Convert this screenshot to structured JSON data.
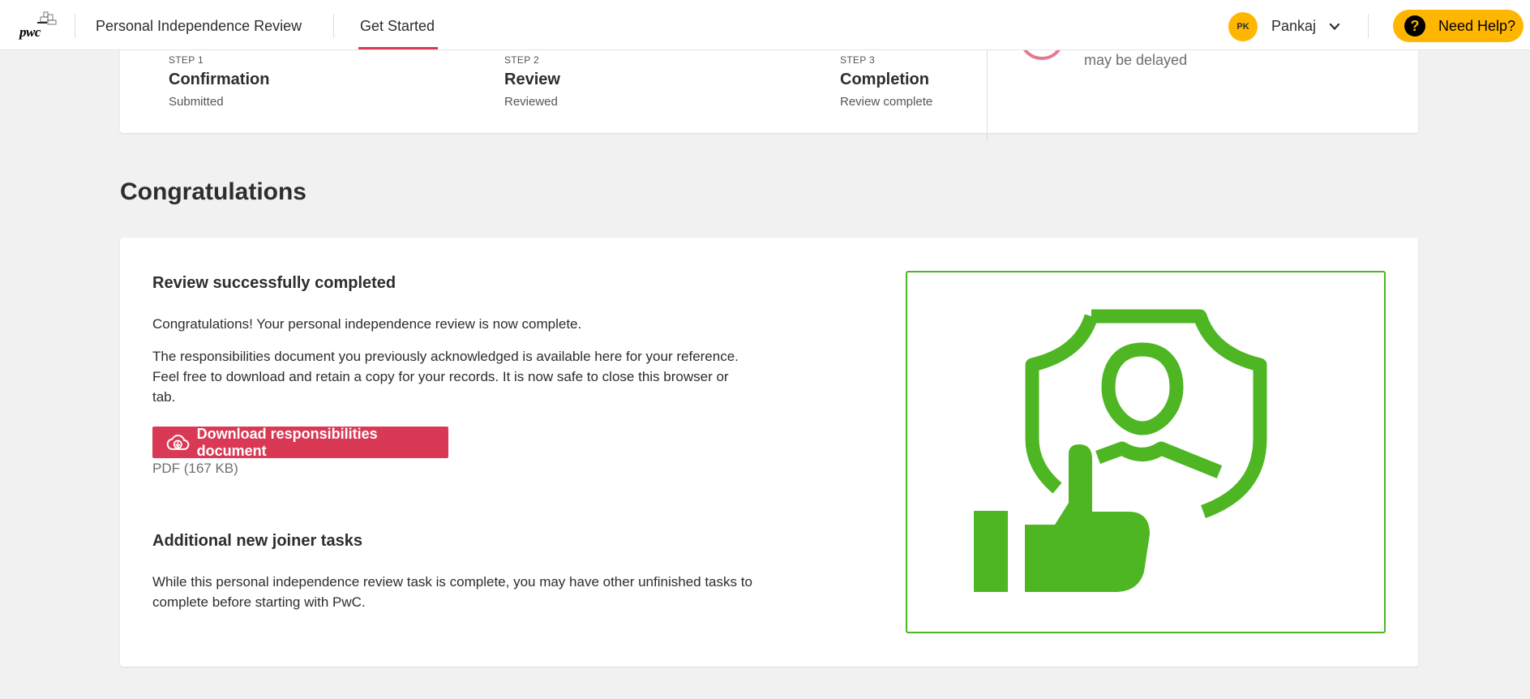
{
  "header": {
    "logo_text": "pwc",
    "app_title": "Personal Independence Review",
    "tab_label": "Get Started",
    "user_initials": "PK",
    "user_name": "Pankaj",
    "help_label": "Need Help?",
    "help_icon_glyph": "?"
  },
  "steps": [
    {
      "number": "STEP 1",
      "title": "Confirmation",
      "status": "Submitted"
    },
    {
      "number": "STEP 2",
      "title": "Review",
      "status": "Reviewed"
    },
    {
      "number": "STEP 3",
      "title": "Completion",
      "status": "Review complete"
    }
  ],
  "status_note": "may be delayed",
  "page_heading": "Congratulations",
  "review": {
    "title": "Review successfully completed",
    "message": "Congratulations! Your personal independence review is now complete.",
    "description": "The responsibilities document you previously acknowledged is available here for your reference. Feel free to download and retain a copy for your records. It is now safe to close this browser or tab.",
    "download_label": "Download responsibilities document",
    "file_meta": "PDF (167 KB)"
  },
  "joiner": {
    "title": "Additional new joiner tasks",
    "description": "While this personal independence review task is complete, you may have other unfinished tasks to complete before starting with PwC."
  },
  "colors": {
    "accent_red": "#d93954",
    "brand_yellow": "#ffb600",
    "success_green": "#4eb523"
  },
  "icons": {
    "download": "cloud-download-icon",
    "help": "question-icon",
    "chevron": "chevron-down-icon",
    "illustration": "shield-person-thumbs-up-icon"
  }
}
